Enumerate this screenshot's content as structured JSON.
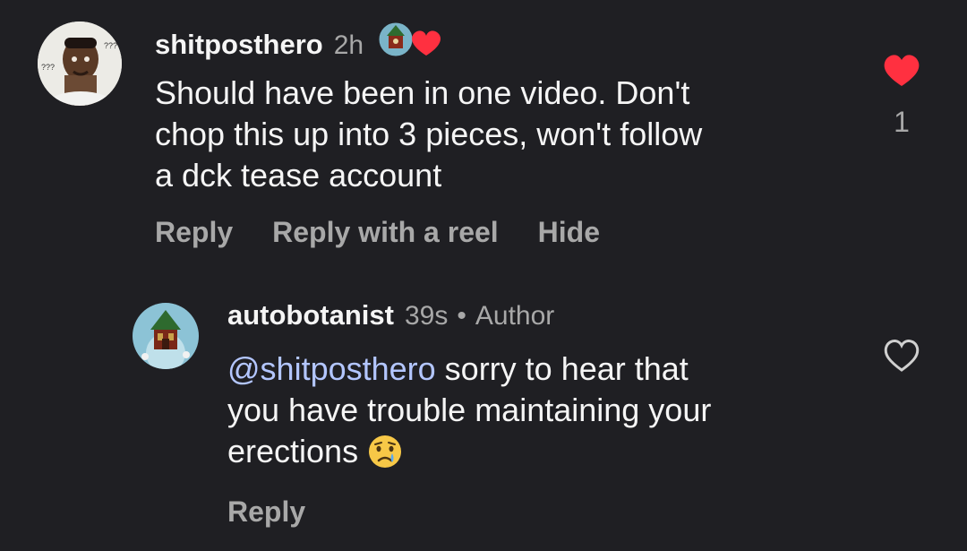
{
  "comments": [
    {
      "username": "shitposthero",
      "time": "2h",
      "text": "Should have been in one video. Don't chop this up into 3 pieces, won't follow a dck tease account",
      "lines": [
        "Should have been in one video. Don't",
        "chop this up into 3 pieces, won't follow",
        "a dck tease account"
      ],
      "like_count": "1",
      "liked": true,
      "actions": [
        "Reply",
        "Reply with a reel",
        "Hide"
      ],
      "avatar_meme_text": [
        "???",
        "???"
      ]
    },
    {
      "username": "autobotanist",
      "time": "39s",
      "separator": "•",
      "author_label": "Author",
      "mention": "@shitposthero",
      "lines_after_mention": [
        " sorry to hear that",
        "you have trouble maintaining your",
        "erections"
      ],
      "emoji": "crying-face",
      "liked": false,
      "actions": [
        "Reply"
      ]
    }
  ],
  "colors": {
    "background": "#1f1f23",
    "primary_text": "#f5f5f5",
    "secondary_text": "#a8a8a8",
    "like_red": "#ff3040",
    "mention": "#b3c6ff"
  }
}
